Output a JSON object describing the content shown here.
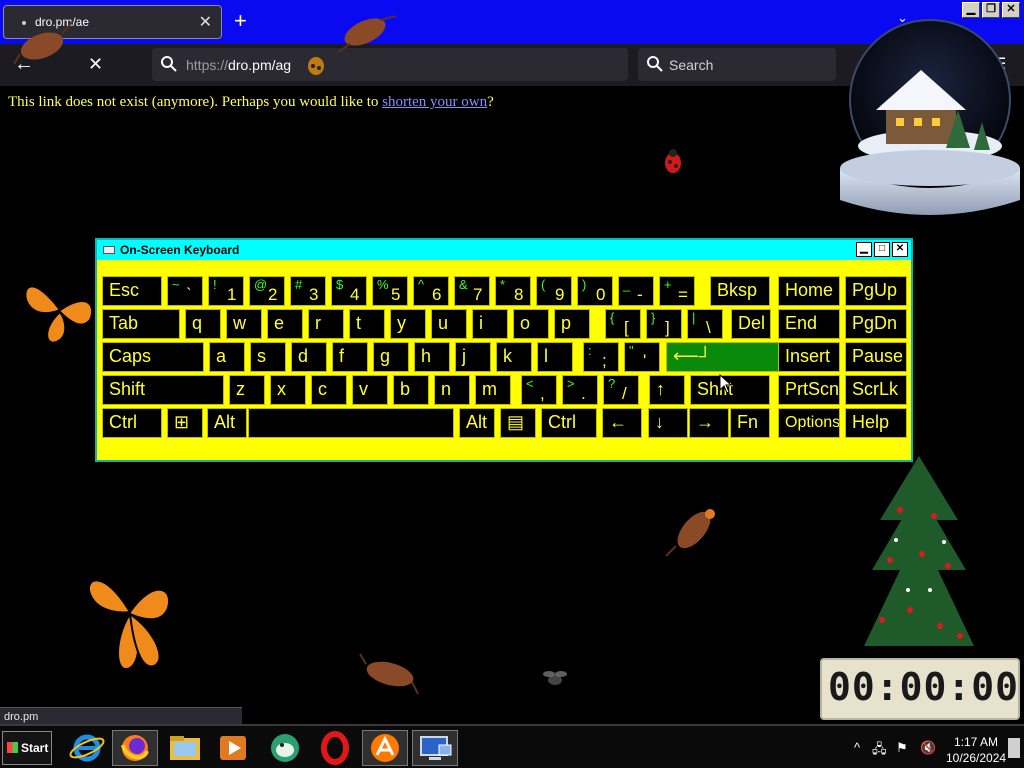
{
  "browser": {
    "tab": {
      "title": "dro.pm/ae",
      "close": "✕"
    },
    "new_tab": "+",
    "list_tabs": "⌄",
    "window": {
      "minimize": "▁",
      "restore": "❐",
      "close": "✕"
    },
    "nav": {
      "back": "←",
      "stop": "✕"
    },
    "url": {
      "scheme": "https://",
      "rest": "dro.pm/ag"
    },
    "search_placeholder": "Search",
    "toolbar": {
      "pocket": "⛉",
      "downloads": "⭳",
      "extensions": "⧉",
      "menu": "☰"
    }
  },
  "page": {
    "message": "This link does not exist (anymore). Perhaps you would like to ",
    "link": "shorten your own",
    "suffix": "?"
  },
  "osk": {
    "title": "On-Screen Keyboard",
    "buttons": {
      "minimize": "▁",
      "maximize": "□",
      "close": "✕"
    },
    "rows": [
      [
        {
          "m": "Esc"
        },
        {
          "s": "~",
          "l": "`"
        },
        {
          "s": "!",
          "l": "1"
        },
        {
          "s": "@",
          "l": "2"
        },
        {
          "s": "#",
          "l": "3"
        },
        {
          "s": "$",
          "l": "4"
        },
        {
          "s": "%",
          "l": "5"
        },
        {
          "s": "^",
          "l": "6"
        },
        {
          "s": "&",
          "l": "7"
        },
        {
          "s": "*",
          "l": "8"
        },
        {
          "s": "(",
          "l": "9"
        },
        {
          "s": ")",
          "l": "0"
        },
        {
          "s": "_",
          "l": "-"
        },
        {
          "s": "+",
          "l": "="
        },
        {
          "m": "Bksp"
        },
        {
          "m": "Home"
        },
        {
          "m": "PgUp"
        }
      ],
      [
        {
          "m": "Tab"
        },
        {
          "m": "q"
        },
        {
          "m": "w"
        },
        {
          "m": "e"
        },
        {
          "m": "r"
        },
        {
          "m": "t"
        },
        {
          "m": "y"
        },
        {
          "m": "u"
        },
        {
          "m": "i"
        },
        {
          "m": "o"
        },
        {
          "m": "p"
        },
        {
          "s": "{",
          "l": "["
        },
        {
          "s": "}",
          "l": "]"
        },
        {
          "s": "|",
          "l": "\\"
        },
        {
          "m": "Del"
        },
        {
          "m": "End"
        },
        {
          "m": "PgDn"
        }
      ],
      [
        {
          "m": "Caps"
        },
        {
          "m": "a"
        },
        {
          "m": "s"
        },
        {
          "m": "d"
        },
        {
          "m": "f"
        },
        {
          "m": "g"
        },
        {
          "m": "h"
        },
        {
          "m": "j"
        },
        {
          "m": "k"
        },
        {
          "m": "l"
        },
        {
          "s": ":",
          "l": ";"
        },
        {
          "s": "\"",
          "l": "'"
        },
        {
          "m": "⟵┘"
        },
        {
          "m": "Insert"
        },
        {
          "m": "Pause"
        }
      ],
      [
        {
          "m": "Shift"
        },
        {
          "m": "z"
        },
        {
          "m": "x"
        },
        {
          "m": "c"
        },
        {
          "m": "v"
        },
        {
          "m": "b"
        },
        {
          "m": "n"
        },
        {
          "m": "m"
        },
        {
          "s": "<",
          "l": ","
        },
        {
          "s": ">",
          "l": "."
        },
        {
          "s": "?",
          "l": "/"
        },
        {
          "m": "↑"
        },
        {
          "m": "Shift"
        },
        {
          "m": "PrtScn"
        },
        {
          "m": "ScrLk"
        }
      ],
      [
        {
          "m": "Ctrl"
        },
        {
          "m": "⊞"
        },
        {
          "m": "Alt"
        },
        {
          "m": ""
        },
        {
          "m": "Alt"
        },
        {
          "m": "▤"
        },
        {
          "m": "Ctrl"
        },
        {
          "m": "←"
        },
        {
          "m": "↓"
        },
        {
          "m": "→"
        },
        {
          "m": "Fn"
        },
        {
          "m": "Options"
        },
        {
          "m": "Help"
        }
      ]
    ]
  },
  "desktop": {
    "countdown": "00:00:00"
  },
  "status_url": "dro.pm",
  "taskbar": {
    "start": "Start",
    "apps": [
      "internet-explorer",
      "firefox",
      "file-explorer",
      "media-player",
      "cyberduck",
      "opera",
      "avast",
      "remote-desktop"
    ],
    "tray": {
      "chevron": "^",
      "time": "1:17 AM",
      "date": "10/26/2024"
    }
  }
}
